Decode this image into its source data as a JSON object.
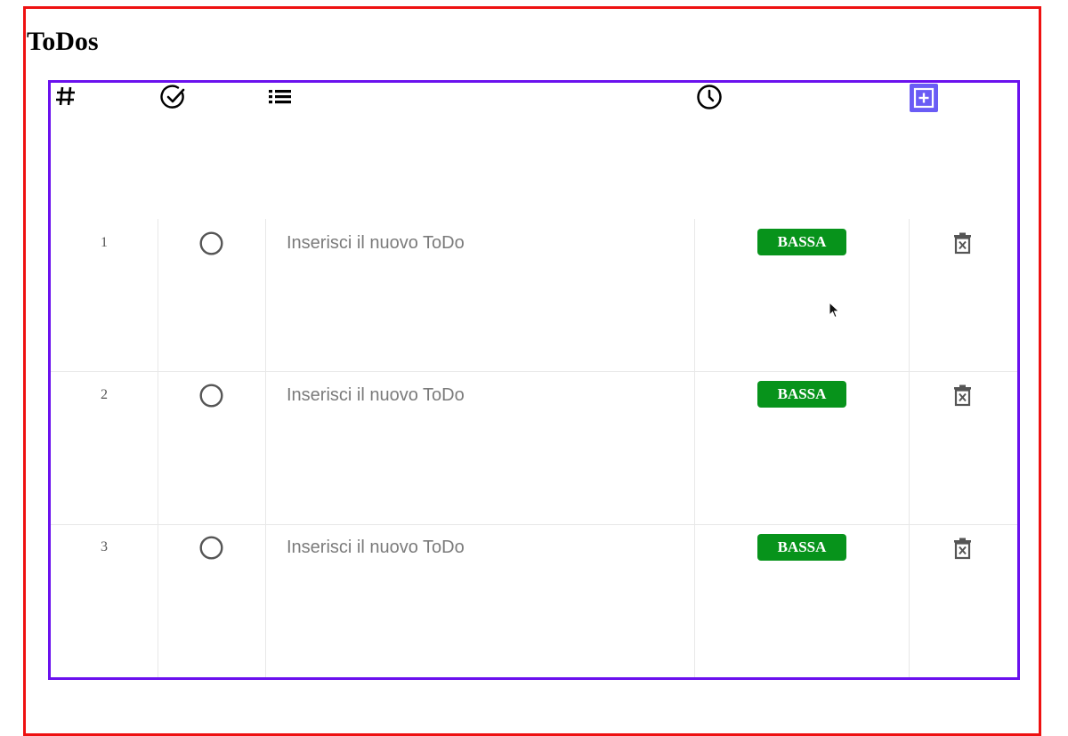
{
  "page": {
    "title": "ToDos"
  },
  "table": {
    "header_icons": [
      "hash-icon",
      "check-circle-icon",
      "list-icon",
      "clock-icon",
      "add-square-icon"
    ],
    "rows": [
      {
        "number": "1",
        "completed": false,
        "text": "",
        "placeholder": "Inserisci il nuovo ToDo",
        "priority": "BASSA",
        "priority_color": "#07931b"
      },
      {
        "number": "2",
        "completed": false,
        "text": "",
        "placeholder": "Inserisci il nuovo ToDo",
        "priority": "BASSA",
        "priority_color": "#07931b"
      },
      {
        "number": "3",
        "completed": false,
        "text": "",
        "placeholder": "Inserisci il nuovo ToDo",
        "priority": "BASSA",
        "priority_color": "#07931b"
      }
    ]
  },
  "colors": {
    "outer_border": "#ee1111",
    "table_border": "#6a11ee",
    "add_button": "#6a5cf5",
    "priority_low": "#07931b"
  }
}
